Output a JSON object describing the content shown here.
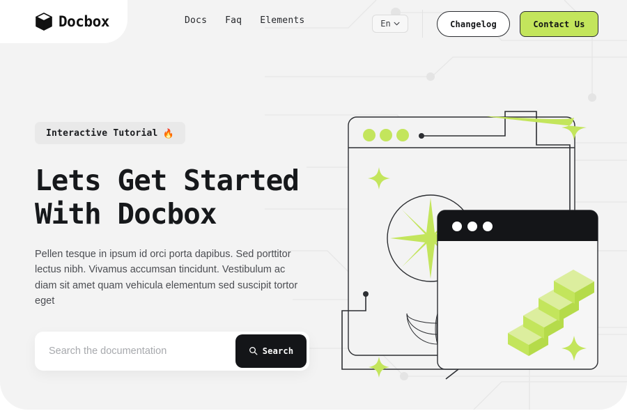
{
  "brand": {
    "name": "Docbox",
    "logo_icon": "cube-icon"
  },
  "colors": {
    "accent_lime": "#c3e55c",
    "dark": "#141518",
    "page_bg": "#f3f3f3",
    "card_bg": "#ffffff",
    "badge_bg": "#e9e9e9",
    "muted_text": "#4b4d52"
  },
  "header": {
    "nav": [
      {
        "label": "Docs",
        "name": "nav-link-docs"
      },
      {
        "label": "Faq",
        "name": "nav-link-faq"
      },
      {
        "label": "Elements",
        "name": "nav-link-elements"
      }
    ],
    "language": {
      "value": "En",
      "icon": "chevron-down-icon"
    },
    "changelog_label": "Changelog",
    "contact_label": "Contact Us"
  },
  "hero": {
    "badge": {
      "text": "Interactive Tutorial",
      "emoji": "🔥"
    },
    "headline": "Lets Get Started\nWith Docbox",
    "subtext": "Pellen tesque in ipsum id orci porta dapibus. Sed porttitor lectus nibh. Vivamus accumsan tincidunt. Vestibulum ac diam sit amet quam vehicula elementum sed suscipit tortor eget",
    "search": {
      "placeholder": "Search the documentation",
      "value": "",
      "button_label": "Search",
      "button_icon": "search-icon"
    }
  },
  "illustration": {
    "back_window": {
      "dots": 3,
      "dot_color": "#c3e55c"
    },
    "front_window": {
      "dots": 3,
      "dot_color": "#ffffff",
      "titlebar_color": "#141518"
    },
    "elements": [
      "starburst",
      "circle-outline",
      "wireframe-globe",
      "isometric-stairs",
      "connector-arrows",
      "sparkles",
      "circuit-traces"
    ],
    "stairs_steps": 4,
    "sparkle_count": 4
  }
}
